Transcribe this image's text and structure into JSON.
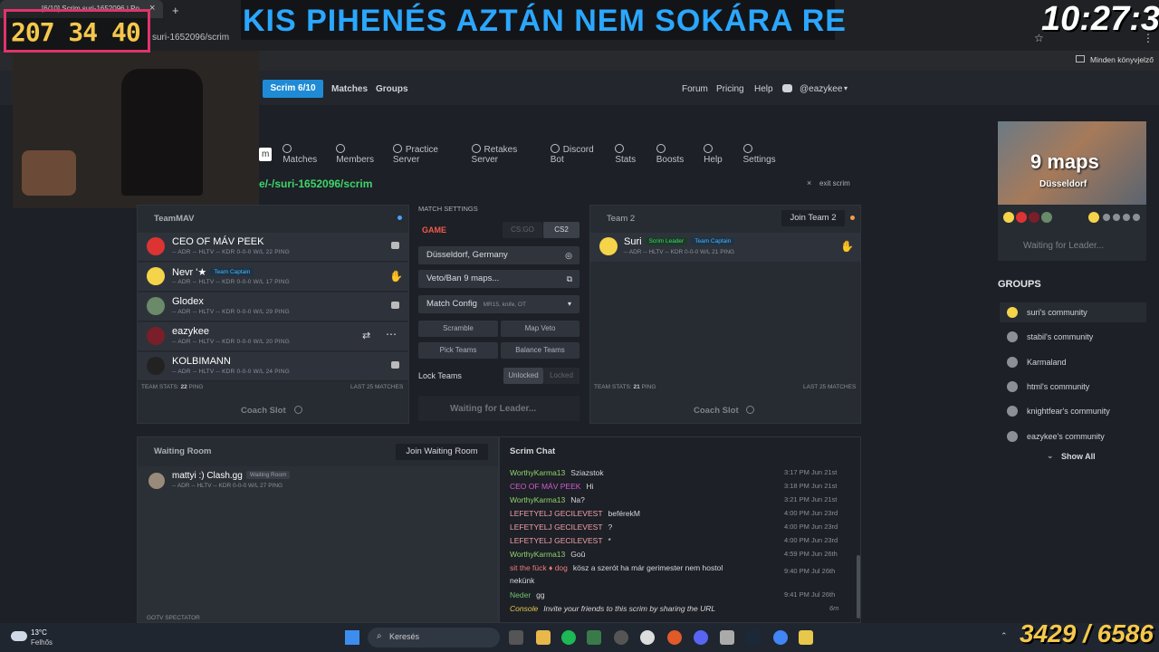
{
  "overlay": {
    "banner": "KIS PIHENÉS AZTÁN NEM SOKÁRA RE",
    "clock": "10:27:31",
    "counter": "207 34 40",
    "score": "3429 / 6586"
  },
  "browser": {
    "tab_title": "[6/10] Scrim suri-1652096 | Po",
    "url": "suri-1652096/scrim",
    "bookmarks_label": "Minden könyvjelző"
  },
  "nav": {
    "scrim": "Scrim 6/10",
    "matches": "Matches",
    "groups": "Groups",
    "forum": "Forum",
    "pricing": "Pricing",
    "help": "Help",
    "user": "@eazykee"
  },
  "subnav": [
    "m",
    "Matches",
    "Members",
    "Practice Server",
    "Retakes Server",
    "Discord Bot",
    "Stats",
    "Boosts",
    "Help",
    "Settings"
  ],
  "scrim_path": "e/-/suri-1652096/scrim",
  "exit": "exit scrim",
  "team1": {
    "name": "TeamMAV",
    "stats_label": "TEAM STATS:",
    "ping": "22",
    "ping_unit": "PING",
    "last": "LAST 25 MATCHES",
    "coach": "Coach Slot",
    "players": [
      {
        "name": "CEO OF MÁV PEEK",
        "badge": "",
        "stats": "-- ADR  -- HLTV  -- KDR  0-0-0 W/L",
        "ping": "22 PING"
      },
      {
        "name": "Nevr '★",
        "badge": "Team Captain",
        "stats": "-- ADR  -- HLTV  -- KDR  0-0-0 W/L",
        "ping": "17 PING"
      },
      {
        "name": "Glodex",
        "badge": "",
        "stats": "-- ADR  -- HLTV  -- KDR  0-0-0 W/L",
        "ping": "29 PING"
      },
      {
        "name": "eazykee",
        "badge": "",
        "stats": "-- ADR  -- HLTV  -- KDR  0-0-0 W/L",
        "ping": "20 PING"
      },
      {
        "name": "KOLBIMANN",
        "badge": "",
        "stats": "-- ADR  -- HLTV  -- KDR  0-0-0 W/L",
        "ping": "24 PING"
      }
    ]
  },
  "team2": {
    "name": "Team 2",
    "join": "Join Team 2",
    "stats_label": "TEAM STATS:",
    "ping": "21",
    "ping_unit": "PING",
    "last": "LAST 25 MATCHES",
    "coach": "Coach Slot",
    "players": [
      {
        "name": "Suri",
        "badge1": "Scrim Leader",
        "badge2": "Team Captain",
        "stats": "-- ADR  -- HLTV  -- KDR  0-0-0 W/L",
        "ping": "21 PING"
      }
    ]
  },
  "settings": {
    "header": "MATCH SETTINGS",
    "game": "GAME",
    "csgo": "CS:GO",
    "cs2": "CS2",
    "location": "Düsseldorf, Germany",
    "veto": "Veto/Ban 9 maps...",
    "config": "Match Config",
    "config_sub": "MR15, knife, OT",
    "scramble": "Scramble",
    "mapveto": "Map Veto",
    "pick": "Pick Teams",
    "balance": "Balance Teams",
    "lock": "Lock Teams",
    "unlocked": "Unlocked",
    "locked": "Locked",
    "waiting": "Waiting for Leader..."
  },
  "waiting_room": {
    "title": "Waiting Room",
    "join": "Join Waiting Room",
    "player": "mattyi :) Clash.gg",
    "badge": "Waiting Room",
    "stats": "-- ADR  -- HLTV  -- KDR  0-0-0 W/L",
    "ping": "27 PING",
    "gotv": "GOTV SPECTATOR"
  },
  "chat": {
    "title": "Scrim Chat",
    "lines": [
      {
        "user": "WorthyKarma13",
        "text": "Sziazstok",
        "time": "3:17 PM Jun 21st",
        "color": "#8fd46b"
      },
      {
        "user": "CEO OF MÁV PEEK",
        "text": "Hi",
        "time": "3:18 PM Jun 21st",
        "color": "#d45ad4"
      },
      {
        "user": "WorthyKarma13",
        "text": "Na?",
        "time": "3:21 PM Jun 21st",
        "color": "#8fd46b"
      },
      {
        "user": "LEFETYELJ GECILEVEST",
        "text": "beférekM",
        "time": "4:00 PM Jun 23rd",
        "color": "#f0a0a8"
      },
      {
        "user": "LEFETYELJ GECILEVEST",
        "text": "?",
        "time": "4:00 PM Jun 23rd",
        "color": "#f0a0a8"
      },
      {
        "user": "LEFETYELJ GECILEVEST",
        "text": "*",
        "time": "4:00 PM Jun 23rd",
        "color": "#f0a0a8"
      },
      {
        "user": "WorthyKarma13",
        "text": "Goû",
        "time": "4:59 PM Jun 26th",
        "color": "#8fd46b"
      },
      {
        "user": "sit the fück ♦ dog",
        "text": "kösz a szerót ha már gerimester nem hostol",
        "time": "9:40 PM Jul 26th",
        "color": "#f07a7a"
      },
      {
        "user": "",
        "text": "nekünk",
        "time": "",
        "color": "#d6d8dc"
      },
      {
        "user": "Neder",
        "text": "gg",
        "time": "9:41 PM Jul 26th",
        "color": "#6fc46f"
      },
      {
        "user": "Console",
        "text": "Invite your friends to this scrim by sharing the URL",
        "time": "6m",
        "color": "#e6c84a"
      }
    ]
  },
  "sidebar": {
    "map_count": "9 maps",
    "map_city": "Düsseldorf",
    "waiting": "Waiting for Leader...",
    "groups_title": "GROUPS",
    "groups": [
      "suri's community",
      "stabil's community",
      "Karmaland",
      "html's community",
      "knightfear's community",
      "eazykee's community"
    ],
    "show_all": "Show All"
  },
  "taskbar": {
    "temp": "13°C",
    "weather": "Felhős",
    "search": "Keresés"
  }
}
